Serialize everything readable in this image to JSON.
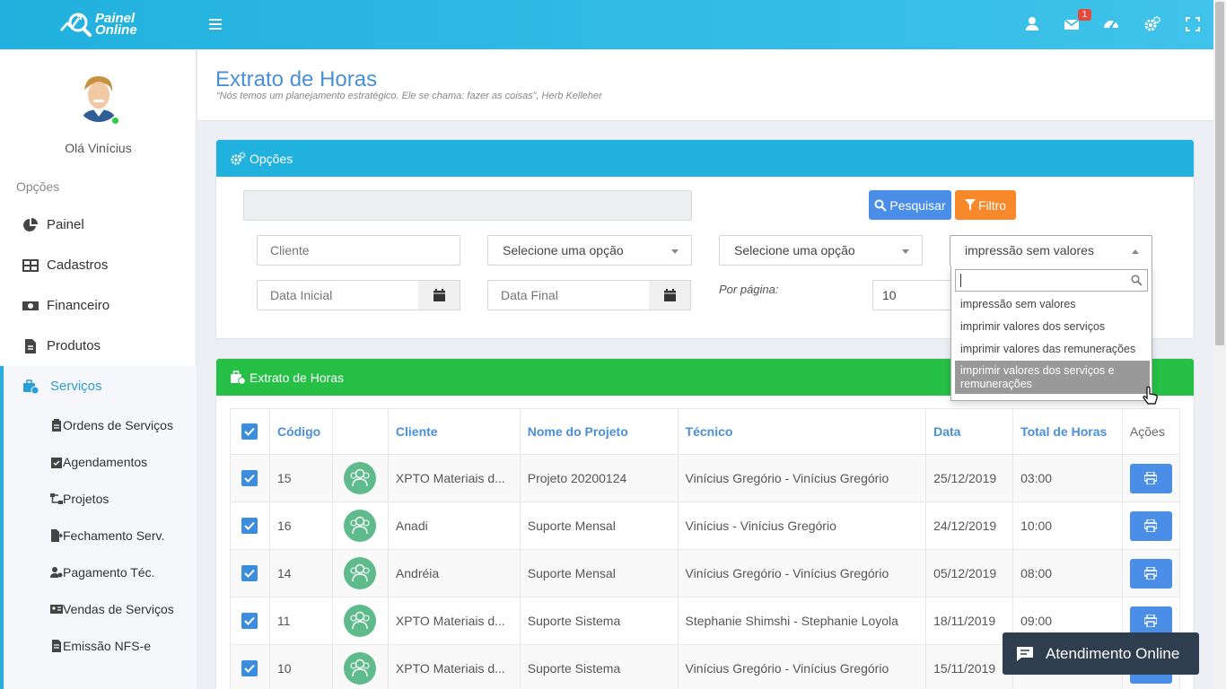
{
  "app": {
    "logo_line1": "Painel",
    "logo_line2": "Online",
    "mail_badge": "1"
  },
  "sidebar": {
    "greeting": "Olá Vinícius",
    "section_label": "Opções",
    "items": [
      {
        "label": "Painel",
        "icon": "pie-chart-icon"
      },
      {
        "label": "Cadastros",
        "icon": "table-icon"
      },
      {
        "label": "Financeiro",
        "icon": "money-icon"
      },
      {
        "label": "Produtos",
        "icon": "file-invoice-icon"
      },
      {
        "label": "Serviços",
        "icon": "toolbox-clock-icon",
        "active": true
      }
    ],
    "sub_items": [
      {
        "label": "Ordens de Serviços",
        "icon": "clipboard-icon"
      },
      {
        "label": "Agendamentos",
        "icon": "calendar-check-icon"
      },
      {
        "label": "Projetos",
        "icon": "sitemap-icon"
      },
      {
        "label": "Fechamento Serv.",
        "icon": "file-export-icon"
      },
      {
        "label": "Pagamento Téc.",
        "icon": "user-cog-icon"
      },
      {
        "label": "Vendas de Serviços",
        "icon": "id-card-icon"
      },
      {
        "label": "Emissão NFS-e",
        "icon": "file-text-icon"
      }
    ]
  },
  "page": {
    "title": "Extrato de Horas",
    "subtitle": "“Nós temos um planejamento estratégico. Ele se chama: fazer as coisas”, Herb Kelleher"
  },
  "options_panel": {
    "title": "Opções",
    "search_button": "Pesquisar",
    "filter_button": "Filtro",
    "client_placeholder": "Cliente",
    "select1_value": "Selecione uma opção",
    "select2_value": "Selecione uma opção",
    "select3_value": "impressão sem valores",
    "date_start_placeholder": "Data Inicial",
    "date_end_placeholder": "Data Final",
    "per_page_label": "Por página:",
    "per_page_value": "10",
    "dropdown_options": [
      "impressão sem valores",
      "imprimir valores dos serviços",
      "imprimir valores das remunerações",
      "imprimir valores dos serviços e remunerações"
    ]
  },
  "table_panel": {
    "title": "Extrato de Horas",
    "headers": {
      "code": "Código",
      "client": "Cliente",
      "project": "Nome do Projeto",
      "tech": "Técnico",
      "date": "Data",
      "hours": "Total de Horas",
      "actions": "Ações"
    },
    "rows": [
      {
        "code": "15",
        "client": "XPTO Materiais d...",
        "project": "Projeto 20200124",
        "tech": "Vinícius Gregório - Vinícius Gregório",
        "date": "25/12/2019",
        "hours": "03:00"
      },
      {
        "code": "16",
        "client": "Anadi",
        "project": "Suporte Mensal",
        "tech": "Vinícius - Vinícius Gregório",
        "date": "24/12/2019",
        "hours": "10:00"
      },
      {
        "code": "14",
        "client": "Andréia",
        "project": "Suporte Mensal",
        "tech": "Vinícius Gregório - Vinícius Gregório",
        "date": "05/12/2019",
        "hours": "08:00"
      },
      {
        "code": "11",
        "client": "XPTO Materiais d...",
        "project": "Suporte Sistema",
        "tech": "Stephanie Shimshi - Stephanie Loyola",
        "date": "18/11/2019",
        "hours": "09:00"
      },
      {
        "code": "10",
        "client": "XPTO Materiais d...",
        "project": "Suporte Sistema",
        "tech": "Vinícius Gregório - Vinícius Gregório",
        "date": "15/11/2019",
        "hours": ""
      }
    ]
  },
  "chat": {
    "label": "Atendimento Online"
  },
  "colors": {
    "topbar": "#21b1de",
    "options_header": "#21b1de",
    "table_header": "#27c046",
    "search_button": "#4a8ee8",
    "filter_button": "#f7892b",
    "chat_bg": "#2e3e4e"
  }
}
